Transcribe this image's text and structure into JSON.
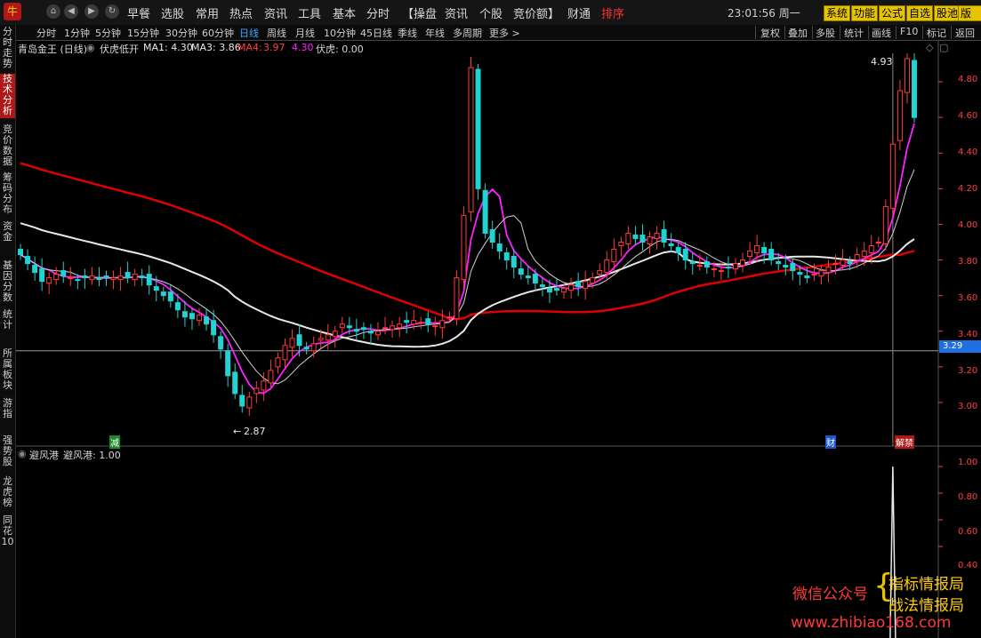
{
  "toolbar": {
    "logo": "牛",
    "menus": [
      "早餐",
      "选股",
      "常用",
      "热点",
      "资讯",
      "工具",
      "基本",
      "分时",
      "【操盘",
      "资讯",
      "个股",
      "竞价额】",
      "财通",
      "排序"
    ],
    "time": "23:01:56 周一",
    "buttons": [
      "系统",
      "功能",
      "公式",
      "自选",
      "股池",
      "版面"
    ]
  },
  "periods": [
    "分时",
    "1分钟",
    "5分钟",
    "15分钟",
    "30分钟",
    "60分钟",
    "日线",
    "周线",
    "月线",
    "10分钟",
    "45日线",
    "季线",
    "年线",
    "多周期",
    "更多 >"
  ],
  "active_period": "日线",
  "tools": [
    "复权",
    "叠加",
    "多股",
    "统计",
    "画线",
    "F10",
    "标记",
    "返回"
  ],
  "sidebar": [
    "分时走势",
    "技术分析",
    "竞价数据",
    "筹码分布",
    "资金",
    "基因分数",
    "统计",
    "所属板块",
    "游指",
    "强势股",
    "龙虎榜",
    "同花10"
  ],
  "sidebar_active": "技术分析",
  "main_indicator": {
    "title": "青岛金王 (日线)",
    "formula": "伏虎低开",
    "ma1": "MA1: 4.30",
    "ma3": "MA3: 3.86",
    "ma4_label": "MA4:",
    "ma4_a": "3.97",
    "ma4_b": "4.30",
    "fuhu": "伏虎: 0.00"
  },
  "sub_indicator": {
    "name": "避风港",
    "value": "避风港: 1.00"
  },
  "price_axis": [
    "4.80",
    "4.60",
    "4.40",
    "4.20",
    "4.00",
    "3.80",
    "3.60",
    "3.40",
    "3.20",
    "3.00"
  ],
  "sub_axis": [
    "1.00",
    "0.80",
    "0.60",
    "0.40"
  ],
  "current_price": "3.29",
  "annotations": {
    "high": "4.93",
    "low": "2.87",
    "tag_green": "减",
    "tag_blue": "财",
    "tag_red": "解禁"
  },
  "watermark": {
    "label": "微信公众号",
    "line1": "指标情报局",
    "line2": "战法情报局",
    "url": "www.zhibiao168.com"
  },
  "colors": {
    "up": "#ff3a3a",
    "down": "#21d3d3",
    "ma_red": "#e00000",
    "ma_white": "#e8e8e8",
    "ma_magenta": "#ff22ff",
    "ma_thin": "#d0d0d0",
    "active_blue": "#39a9ff",
    "accent_yellow": "#e6c400"
  },
  "chart_data": {
    "type": "candlestick",
    "ylim": [
      2.85,
      4.95
    ],
    "sub_ylim": [
      0,
      1.1
    ],
    "closes": [
      3.83,
      3.78,
      3.73,
      3.68,
      3.7,
      3.72,
      3.71,
      3.7,
      3.69,
      3.7,
      3.71,
      3.69,
      3.7,
      3.7,
      3.71,
      3.7,
      3.72,
      3.7,
      3.66,
      3.63,
      3.6,
      3.57,
      3.52,
      3.48,
      3.47,
      3.49,
      3.44,
      3.38,
      3.3,
      3.15,
      3.05,
      2.98,
      3.03,
      3.08,
      3.12,
      3.18,
      3.25,
      3.32,
      3.36,
      3.32,
      3.3,
      3.33,
      3.36,
      3.38,
      3.4,
      3.44,
      3.42,
      3.4,
      3.41,
      3.39,
      3.4,
      3.42,
      3.43,
      3.44,
      3.45,
      3.46,
      3.45,
      3.44,
      3.43,
      3.46,
      3.48,
      3.7,
      4.05,
      4.88,
      4.2,
      3.95,
      3.9,
      3.85,
      3.8,
      3.76,
      3.72,
      3.7,
      3.67,
      3.65,
      3.62,
      3.63,
      3.64,
      3.66,
      3.65,
      3.68,
      3.7,
      3.74,
      3.8,
      3.86,
      3.9,
      3.95,
      3.92,
      3.9,
      3.93,
      3.95,
      3.9,
      3.88,
      3.84,
      3.8,
      3.78,
      3.77,
      3.76,
      3.75,
      3.74,
      3.76,
      3.78,
      3.8,
      3.85,
      3.88,
      3.84,
      3.8,
      3.78,
      3.76,
      3.74,
      3.72,
      3.7,
      3.72,
      3.74,
      3.76,
      3.78,
      3.8,
      3.78,
      3.83,
      3.85,
      3.88,
      3.9,
      4.1,
      4.45,
      4.75,
      4.93,
      4.6
    ],
    "spike_index": 122
  }
}
